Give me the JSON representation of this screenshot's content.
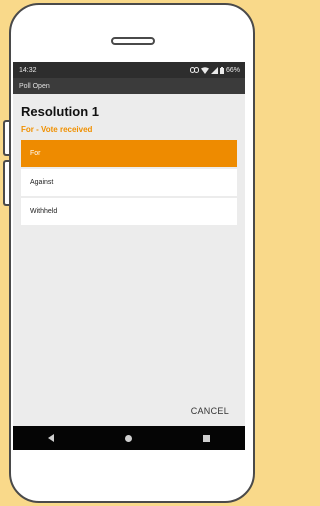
{
  "status_bar": {
    "time": "14:32",
    "battery": "66%"
  },
  "app_bar": {
    "title": "Poll Open"
  },
  "resolution": {
    "title": "Resolution 1",
    "status": "For - Vote received"
  },
  "options": [
    {
      "label": "For",
      "selected": true
    },
    {
      "label": "Against",
      "selected": false
    },
    {
      "label": "Withheld",
      "selected": false
    }
  ],
  "actions": {
    "cancel_label": "CANCEL"
  },
  "colors": {
    "accent": "#ee8b00",
    "background": "#f9d98a"
  }
}
